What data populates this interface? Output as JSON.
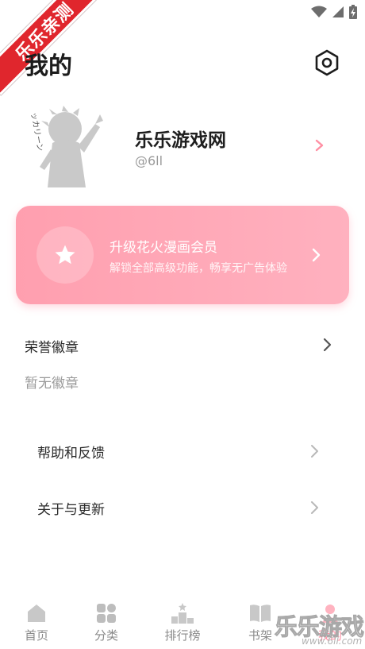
{
  "watermark": {
    "ribbon_text": "乐乐亲测",
    "corner_text": "乐乐游戏",
    "corner_url": "www.6ll.com"
  },
  "header": {
    "title": "我的",
    "settings_icon": "hexagon-gear-icon"
  },
  "profile": {
    "name": "乐乐游戏网",
    "handle": "@6ll",
    "avatar_caption": "ッカリーン"
  },
  "vip": {
    "title": "升级花火漫画会员",
    "subtitle": "解锁全部高级功能，畅享无广告体验",
    "icon": "star-icon"
  },
  "badges": {
    "title": "荣誉徽章",
    "empty_text": "暂无徽章"
  },
  "menu": [
    {
      "label": "帮助和反馈"
    },
    {
      "label": "关于与更新"
    }
  ],
  "nav": [
    {
      "label": "首页",
      "icon": "home-icon"
    },
    {
      "label": "分类",
      "icon": "grid-icon"
    },
    {
      "label": "排行榜",
      "icon": "podium-icon"
    },
    {
      "label": "书架",
      "icon": "book-icon"
    },
    {
      "label": "我的",
      "icon": "profile-icon"
    }
  ],
  "colors": {
    "accent": "#ff8fa3",
    "vip_gradient_start": "#ff9faf",
    "vip_gradient_end": "#ffb1bf"
  }
}
